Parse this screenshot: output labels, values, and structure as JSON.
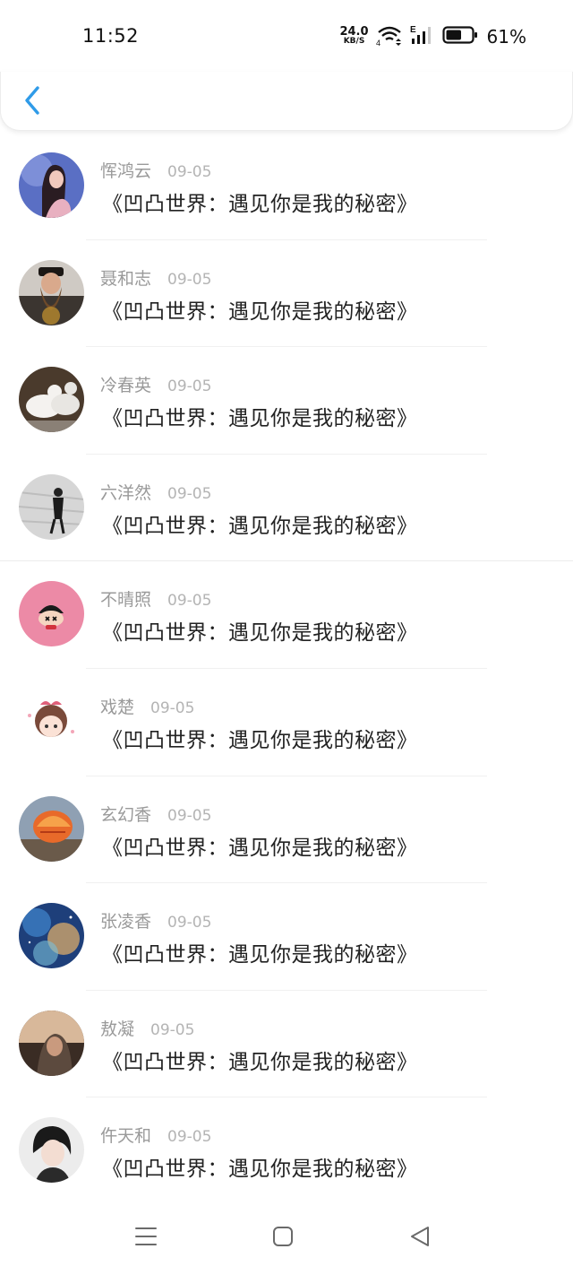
{
  "status_bar": {
    "time": "11:52",
    "net_speed_value": "24.0",
    "net_speed_unit": "KB/S",
    "network_type": "E",
    "wifi_label": "4",
    "battery_level": 61,
    "battery_percent": "61%"
  },
  "header": {
    "back_icon": "chevron-left-icon",
    "accent_color": "#2f9be8"
  },
  "comments": [
    {
      "name": "恽鸿云",
      "date": "09-05",
      "text": "《凹凸世界：遇见你是我的秘密》"
    },
    {
      "name": "聂和志",
      "date": "09-05",
      "text": "《凹凸世界：遇见你是我的秘密》"
    },
    {
      "name": "冷春英",
      "date": "09-05",
      "text": "《凹凸世界：遇见你是我的秘密》"
    },
    {
      "name": "六洋然",
      "date": "09-05",
      "text": "《凹凸世界：遇见你是我的秘密》"
    },
    {
      "name": "不晴照",
      "date": "09-05",
      "text": "《凹凸世界：遇见你是我的秘密》"
    },
    {
      "name": "戏楚",
      "date": "09-05",
      "text": "《凹凸世界：遇见你是我的秘密》"
    },
    {
      "name": "玄幻香",
      "date": "09-05",
      "text": "《凹凸世界：遇见你是我的秘密》"
    },
    {
      "name": "张凌香",
      "date": "09-05",
      "text": "《凹凸世界：遇见你是我的秘密》"
    },
    {
      "name": "敖凝",
      "date": "09-05",
      "text": "《凹凸世界：遇见你是我的秘密》"
    },
    {
      "name": "仵天和",
      "date": "09-05",
      "text": "《凹凸世界：遇见你是我的秘密》"
    }
  ],
  "nav_bar": {
    "menu_icon": "menu-icon",
    "home_icon": "home-square-icon",
    "back_icon": "back-triangle-icon"
  }
}
